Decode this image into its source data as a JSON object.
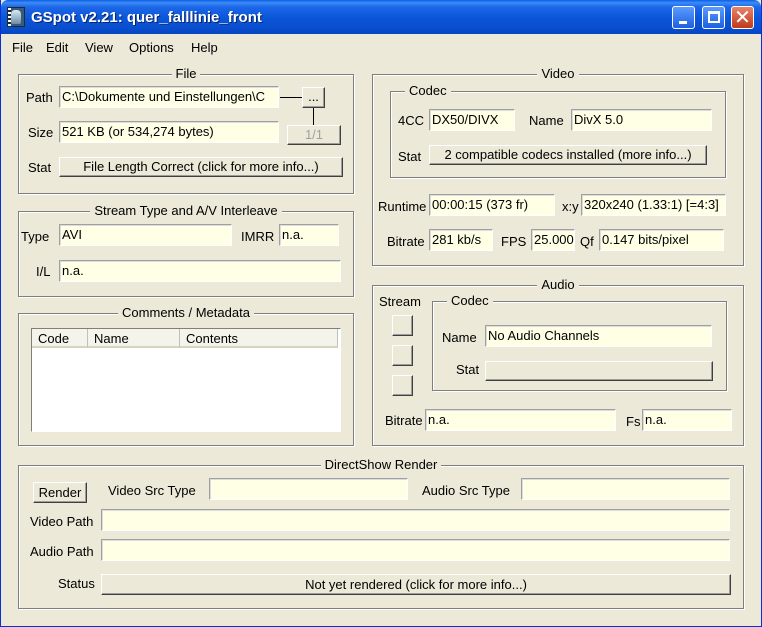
{
  "window": {
    "title": "GSpot v2.21:  quer_falllinie_front",
    "controls": {
      "minimize": "",
      "maximize": "",
      "close": "✕"
    }
  },
  "menu": [
    "File",
    "Edit",
    "View",
    "Options",
    "Help"
  ],
  "file": {
    "title": "File",
    "path_label": "Path",
    "path_value": "C:\\Dokumente und Einstellungen\\C",
    "browse_label": "...",
    "size_label": "Size",
    "size_value": "521 KB (or 534,274 bytes)",
    "page_counter": "1/1",
    "stat_label": "Stat",
    "stat_button": "File Length Correct (click for more info...)"
  },
  "stream": {
    "title": "Stream Type and A/V Interleave",
    "type_label": "Type",
    "type_value": "AVI",
    "imrr_label": "IMRR",
    "imrr_value": "n.a.",
    "il_label": "I/L",
    "il_value": "n.a."
  },
  "comments": {
    "title": "Comments / Metadata",
    "columns": [
      "Code",
      "Name",
      "Contents"
    ],
    "rows": []
  },
  "video": {
    "title": "Video",
    "codec_title": "Codec",
    "fourcc_label": "4CC",
    "fourcc_value": "DX50/DIVX",
    "name_label": "Name",
    "name_value": "DivX 5.0",
    "stat_label": "Stat",
    "stat_button": "2 compatible codecs installed (more info...)",
    "runtime_label": "Runtime",
    "runtime_value": "00:00:15 (373 fr)",
    "xy_label": "x:y",
    "xy_value": "320x240 (1.33:1) [=4:3]",
    "bitrate_label": "Bitrate",
    "bitrate_value": "281 kb/s",
    "fps_label": "FPS",
    "fps_value": "25.000",
    "qf_label": "Qf",
    "qf_value": "0.147 bits/pixel"
  },
  "audio": {
    "title": "Audio",
    "stream_label": "Stream",
    "codec_title": "Codec",
    "name_label": "Name",
    "name_value": "No Audio Channels",
    "stat_label": "Stat",
    "stat_value": "",
    "bitrate_label": "Bitrate",
    "bitrate_value": "n.a.",
    "fs_label": "Fs",
    "fs_value": "n.a."
  },
  "directshow": {
    "title": "DirectShow Render",
    "render_button": "Render",
    "video_src_type_label": "Video Src Type",
    "video_src_type_value": "",
    "audio_src_type_label": "Audio Src Type",
    "audio_src_type_value": "",
    "video_path_label": "Video Path",
    "video_path_value": "",
    "audio_path_label": "Audio Path",
    "audio_path_value": "",
    "status_label": "Status",
    "status_button": "Not yet rendered (click for more info...)"
  }
}
